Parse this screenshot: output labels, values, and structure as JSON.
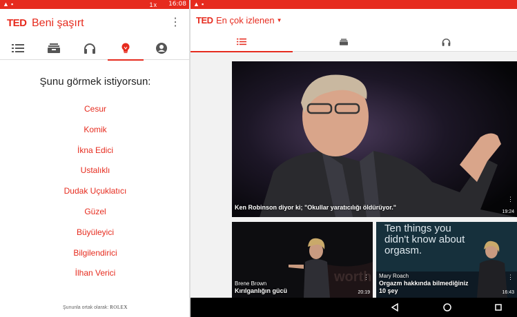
{
  "status_bar": {
    "time": "16:08",
    "warning_icon": "warning-icon",
    "image_icon": "image-icon",
    "signal_text": "1x"
  },
  "left_screen": {
    "logo": "TED",
    "title": "Beni şaşırt",
    "overflow_icon": "overflow-menu-icon",
    "tabs": [
      {
        "icon": "list-icon",
        "active": false
      },
      {
        "icon": "playlist-icon",
        "active": false
      },
      {
        "icon": "headphones-icon",
        "active": false
      },
      {
        "icon": "lightbulb-icon",
        "active": true
      },
      {
        "icon": "account-icon",
        "active": false
      }
    ],
    "question": "Şunu görmek istiyorsun:",
    "moods": [
      "Cesur",
      "Komik",
      "İkna Edici",
      "Ustalıklı",
      "Dudak Uçuklatıcı",
      "Güzel",
      "Büyüleyici",
      "Bilgilendirici",
      "İlhan Verici"
    ],
    "partner_text": "Şununla ortak olarak:",
    "partner_brand": "ROLEX"
  },
  "right_screen": {
    "logo": "TED",
    "title": "En çok izlenen",
    "tabs": [
      {
        "icon": "list-icon",
        "active": true
      },
      {
        "icon": "playlist-icon",
        "active": false
      },
      {
        "icon": "headphones-icon",
        "active": false
      }
    ],
    "talks": [
      {
        "speaker": "",
        "title": "Ken Robinson diyor ki; \"Okullar yaratıcılığı öldürüyor.\"",
        "duration": "19:24"
      },
      {
        "speaker": "Brene Brown",
        "title": "Kırılganlığın gücü",
        "duration": "20:19"
      },
      {
        "speaker": "Mary Roach",
        "title": "Orgazm hakkında bilmediğiniz 10 şey",
        "duration": "16:43",
        "slide_text": "Ten things you didn't know about orgasm."
      }
    ],
    "nav": [
      "back-icon",
      "home-icon",
      "recents-icon"
    ]
  },
  "colors": {
    "accent": "#e62b1e",
    "text": "#222222",
    "nav_bar": "#000000"
  }
}
